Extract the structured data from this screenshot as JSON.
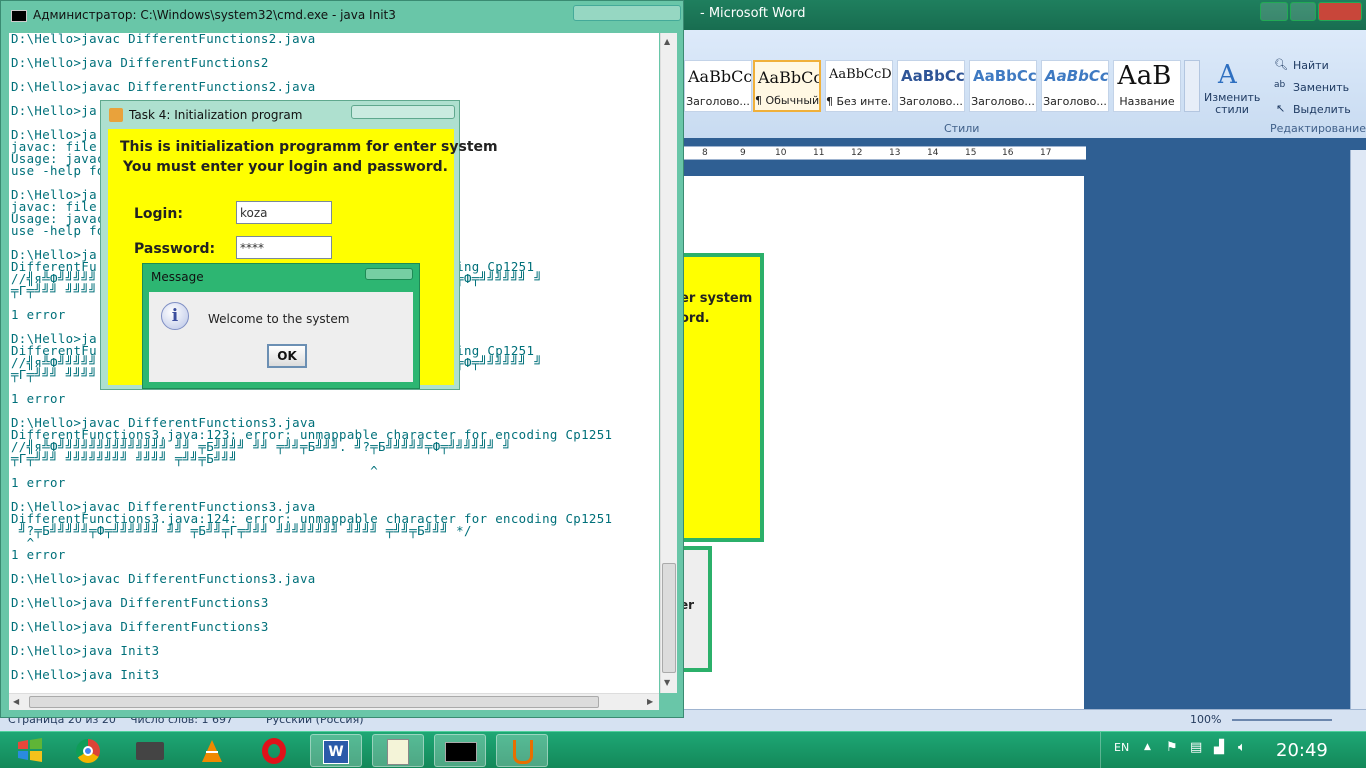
{
  "word": {
    "title": "- Microsoft Word",
    "styles": [
      {
        "sample": "AaBbCc",
        "name": "Заголово..."
      },
      {
        "sample": "AaBbCc",
        "name": "¶ Обычный"
      },
      {
        "sample": "AaBbCcD",
        "name": "¶ Без инте..."
      },
      {
        "sample": "AaBbCc",
        "name": "Заголово..."
      },
      {
        "sample": "AaBbCc",
        "name": "Заголово..."
      },
      {
        "sample": "AaBbCc",
        "name": "Заголово..."
      },
      {
        "sample": "АаВ",
        "name": "Название"
      }
    ],
    "change_styles": "Изменить стили",
    "styles_group": "Стили",
    "find": "Найти",
    "replace": "Заменить",
    "select": "Выделить",
    "editing_group": "Редактирование",
    "ruler_marks": [
      "8",
      "9",
      "10",
      "11",
      "12",
      "13",
      "14",
      "15",
      "16",
      "17"
    ],
    "status_page": "Страница 20 из 20",
    "status_words": "Число слов: 1 697",
    "status_lang": "Русский (Россия)",
    "zoom": "100%"
  },
  "cmd": {
    "title": "Администратор: C:\\Windows\\system32\\cmd.exe - java  Init3",
    "lines": [
      "D:\\Hello>javac DifferentFunctions2.java",
      "",
      "D:\\Hello>java DifferentFunctions2",
      "",
      "D:\\Hello>javac DifferentFunctions2.java",
      "",
      "D:\\Hello>ja",
      "",
      "D:\\Hello>ja",
      "javac: file",
      "Usage: javac",
      "use -help fo",
      "",
      "D:\\Hello>ja",
      "javac: file",
      "Usage: javac",
      "use -help fo",
      "",
      "D:\\Hello>ja                                   ",
      "DifferentFu                                   r for encoding Cp1251",
      "//╣я╩Ф╝╝╝╝╝                                   . ╝?╤Б╝╝╝╝╝╤Ф╤╝╝╝╝╝╝ ╝",
      "╤Г╤╝╝╝ ╝╝╝╝                                   ",
      "                                              ^",
      "1 error",
      "",
      "D:\\Hello>ja",
      "DifferentFu                                   r for encoding Cp1251",
      "//╣я╩Ф╝╝╝╝╝                                   . ╝?╤Б╝╝╝╝╝╤Ф╤╝╝╝╝╝╝ ╝",
      "╤Г╤╝╝╝ ╝╝╝╝                                   ",
      "                                              ^",
      "1 error",
      "",
      "D:\\Hello>javac DifferentFunctions3.java",
      "DifferentFunctions3.java:123: error: unmappable character for encoding Cp1251",
      "//╣я╩Ф╝╝╝╝╝╝╝╝╝╝╝╝╝╝ ╝╝ ╤Б╝╝╝╝ ╝╝ ╤╝╝╤Б╝╝╝. ╝?╤Б╝╝╝╝╝╤Ф╤╝╝╝╝╝╝ ╝",
      "╤Г╤╝╝╝ ╝╝╝╝╝╝╝╝ ╝╝╝╝ ╤╝╝╤Б╝╝╝",
      "                                              ^",
      "1 error",
      "",
      "D:\\Hello>javac DifferentFunctions3.java",
      "DifferentFunctions3.java:124: error: unmappable character for encoding Cp1251",
      " ╝?╤Б╝╝╝╝╝╤Ф╤╝╝╝╝╝╝ ╝╝ ╤Б╝╝╤Г╤╝╝╝ ╝╝╝╝╝╝╝╝ ╝╝╝╝ ╤╝╝╤Б╝╝╝ */",
      "  ^",
      "1 error",
      "",
      "D:\\Hello>javac DifferentFunctions3.java",
      "",
      "D:\\Hello>java DifferentFunctions3",
      "",
      "D:\\Hello>java DifferentFunctions3",
      "",
      "D:\\Hello>java Init3",
      "",
      "D:\\Hello>java Init3"
    ]
  },
  "task": {
    "title": "Task 4: Initialization program",
    "line1": "This is initialization programm for enter system",
    "line2": "You must enter your login and password.",
    "login_label": "Login:",
    "login_value": "koza",
    "password_label": "Password:",
    "password_value": "****"
  },
  "ghost": {
    "line1": "er system",
    "line2": "ord.",
    "line3": "er"
  },
  "message": {
    "title": "Message",
    "text": "Welcome to the system",
    "ok": "OK"
  },
  "taskbar": {
    "lang": "EN",
    "clock": "20:49"
  }
}
